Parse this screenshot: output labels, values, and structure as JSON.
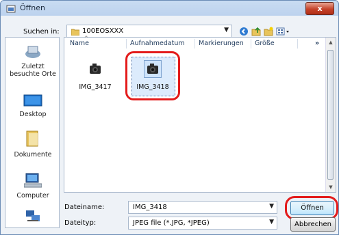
{
  "window": {
    "title": "Öffnen",
    "close_label": "x"
  },
  "toolbar": {
    "lookin_label": "Suchen in:",
    "lookin_value": "100EOSXXX",
    "icons": [
      "back-icon",
      "up-folder-icon",
      "new-folder-icon",
      "view-menu-icon"
    ]
  },
  "places": [
    {
      "label": "Zuletzt besuchte Orte",
      "icon": "recent-places-icon"
    },
    {
      "label": "Desktop",
      "icon": "desktop-icon"
    },
    {
      "label": "Dokumente",
      "icon": "documents-icon"
    },
    {
      "label": "Computer",
      "icon": "computer-icon"
    },
    {
      "label": "",
      "icon": "network-icon"
    }
  ],
  "list": {
    "columns": [
      "Name",
      "Aufnahmedatum",
      "Markierungen",
      "Größe"
    ],
    "more_columns": "»",
    "files": [
      {
        "name": "IMG_3417",
        "icon": "camera-file-icon",
        "selected": false
      },
      {
        "name": "IMG_3418",
        "icon": "camera-file-icon",
        "selected": true
      }
    ]
  },
  "bottom": {
    "filename_label": "Dateiname:",
    "filename_value": "IMG_3418",
    "filetype_label": "Dateityp:",
    "filetype_value": "JPEG file (*.JPG, *JPEG)",
    "open_button": "Öffnen",
    "cancel_button": "Abbrechen"
  },
  "colors": {
    "highlight_ring": "#e31b1b",
    "selection": "#dcebfc"
  }
}
